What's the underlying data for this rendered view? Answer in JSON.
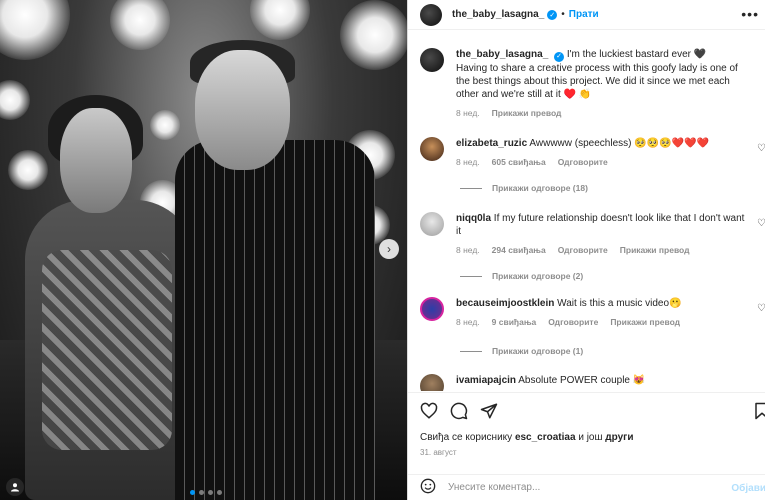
{
  "post": {
    "author": "the_baby_lasagna_",
    "follow_label": "Прати",
    "more_label": "•••",
    "caption_emoji_end": "🖤",
    "caption_lines": [
      "I'm the luckiest bastard ever 🖤",
      "Having to share a creative process with this goofy lady is one of the best things about this project. We did it since we met each other and we're still at it ♥️ 👏"
    ],
    "caption_time": "8 нед.",
    "caption_translate": "Прикажи превод",
    "photo_nav_next": "›",
    "carousel_dots": 4
  },
  "comments": [
    {
      "username": "elizabeta_ruzic",
      "text": "Awwwww (speechless) 🥺🥺🥺❤️❤️❤️",
      "time": "8 нед.",
      "likes": "605 свиђања",
      "reply": "Одговорите",
      "replies_label": "Прикажи одговоре (18)"
    },
    {
      "username": "niqq0la",
      "text": "If my future relationship doesn't look like that I don't want it",
      "time": "8 нед.",
      "likes": "294 свиђања",
      "reply": "Одговорите",
      "translate": "Прикажи превод",
      "replies_label": "Прикажи одговоре (2)"
    },
    {
      "username": "becauseimjoostklein",
      "text": "Wait is this a music video🫢",
      "time": "8 нед.",
      "likes": "9 свиђања",
      "reply": "Одговорите",
      "translate": "Прикажи превод",
      "replies_label": "Прикажи одговоре (1)"
    },
    {
      "username": "ivamiapajcin",
      "text": "Absolute POWER couple 😻"
    }
  ],
  "footer": {
    "likes_prefix": "Свиђа се кориснику",
    "likes_user": "esc_croatiaa",
    "likes_mid": "и још",
    "likes_others": "други",
    "date": "31. август",
    "comment_placeholder": "Унесите коментар...",
    "post_button": "Објави"
  },
  "icons": {
    "heart": "heart-icon",
    "comment": "comment-icon",
    "share": "share-icon",
    "save": "bookmark-icon",
    "emoji": "emoji-icon"
  },
  "colors": {
    "accent": "#0095f6",
    "muted": "#8e8e8e",
    "text": "#262626"
  }
}
